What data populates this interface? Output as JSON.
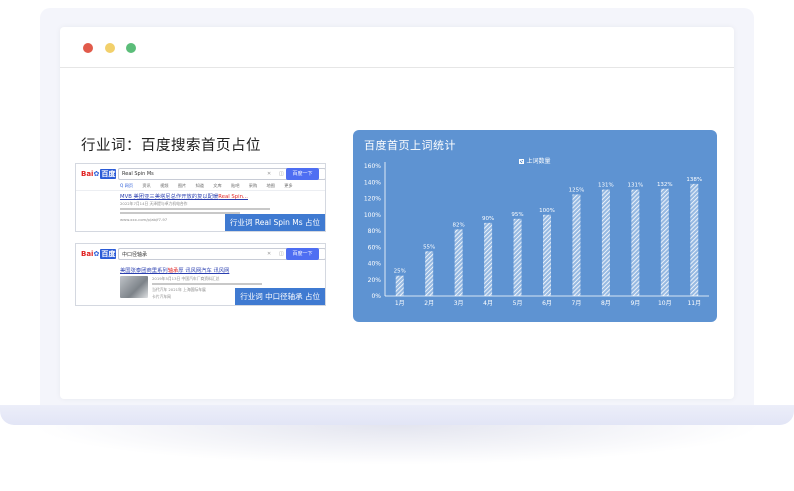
{
  "section_title": "行业词：百度搜索首页占位",
  "serp1": {
    "logo_text": "Bai",
    "logo_paw": "✿",
    "logo_du": "百度",
    "query": "Real Spin Ms",
    "button": "百度一下",
    "tabs": [
      "Q 网页",
      "资讯",
      "视频",
      "图片",
      "知道",
      "文库",
      "贴吧",
      "采购",
      "地图",
      "更多"
    ],
    "result_title_prefix": "MVB 美团亚三美塔尼总作",
    "result_title_mid": "开放的复以配暖",
    "result_title_hl": "Real Spin...",
    "result_date": "2022年7月14日 天泽提与卓力机电合作",
    "result_source": "www.xxx.com/p/ab/f7-97",
    "badge": "行业词 Real Spin Ms 占位"
  },
  "serp2": {
    "logo_text": "Bai",
    "logo_paw": "✿",
    "logo_du": "百度",
    "query": "中口径轴承",
    "button": "百度一下",
    "result_title_prefix": "美国张泰团商里系列",
    "result_title_hl": "轴承",
    "result_title_suffix": "厚 讯风网汽车 讯风网",
    "snippet1": "2019年5月13日 中国汽车厂商资料汇总",
    "snippet2": "当代汽车 2021年 上海国际车展",
    "snippet3": "卡片汽车网",
    "badge": "行业词 中口径轴承 占位"
  },
  "chart_data": {
    "type": "bar",
    "title": "百度首页上词统计",
    "legend": "上词数量",
    "categories": [
      "1月",
      "2月",
      "3月",
      "4月",
      "5月",
      "6月",
      "7月",
      "8月",
      "9月",
      "10月",
      "11月"
    ],
    "series": [
      {
        "name": "上词数量",
        "values": [
          25,
          55,
          82,
          90,
          95,
          100,
          125,
          131,
          131,
          132,
          138
        ]
      }
    ],
    "data_labels": [
      "25%",
      "55%",
      "82%",
      "90%",
      "95%",
      "100%",
      "125%",
      "131%",
      "131%",
      "132%",
      "138%"
    ],
    "yticks": [
      "0%",
      "20%",
      "40%",
      "60%",
      "80%",
      "100%",
      "120%",
      "140%",
      "160%"
    ],
    "ylim": [
      0,
      160
    ],
    "grid": false,
    "legend_position": "top-center",
    "colors": {
      "panel": "#5e93d2",
      "bar": "#ffffff"
    }
  }
}
